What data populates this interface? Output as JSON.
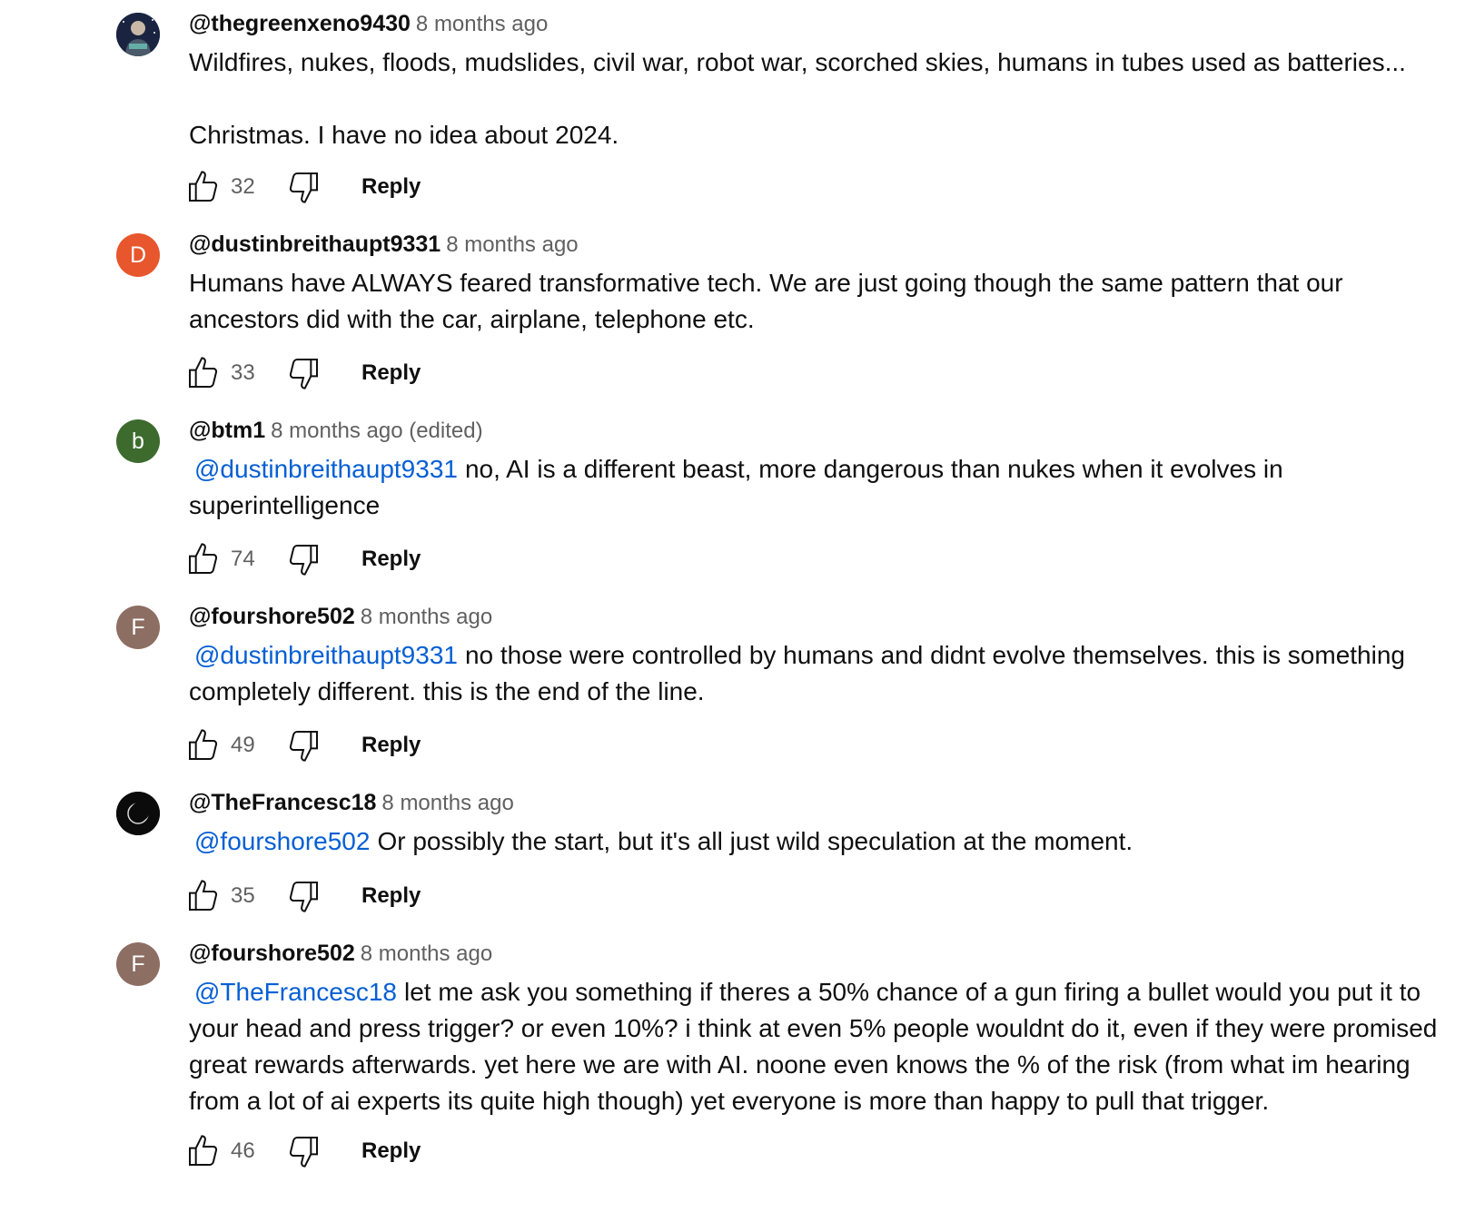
{
  "comments": [
    {
      "author": "@thegreenxeno9430",
      "time": "8 months ago",
      "avatar": {
        "letter": "",
        "color": "#1a2a4a",
        "icon": "profile-photo"
      },
      "mention": "",
      "text": "Wildfires, nukes, floods, mudslides, civil war, robot war, scorched skies, humans in tubes used as batteries...\n\nChristmas. I have no idea about 2024.",
      "likes": "32",
      "reply_label": "Reply"
    },
    {
      "author": "@dustinbreithaupt9331",
      "time": "8 months ago",
      "avatar": {
        "letter": "D",
        "color": "#e8562d"
      },
      "mention": "",
      "text": "Humans have ALWAYS feared transformative tech. We are just going though the same pattern that our\nancestors did with the car, airplane, telephone etc.",
      "likes": "33",
      "reply_label": "Reply"
    },
    {
      "author": "@btm1",
      "time": "8 months ago (edited)",
      "avatar": {
        "letter": "b",
        "color": "#3d6b2e"
      },
      "mention": "@dustinbreithaupt9331",
      "text": "no, AI is a different beast, more dangerous than nukes when it evolves in\nsuperintelligence",
      "likes": "74",
      "reply_label": "Reply"
    },
    {
      "author": "@fourshore502",
      "time": "8 months ago",
      "avatar": {
        "letter": "F",
        "color": "#8d6e63"
      },
      "mention": "@dustinbreithaupt9331",
      "text": "no those were controlled by humans and didnt evolve themselves. this is something\ncompletely different. this is the end of the line.",
      "likes": "49",
      "reply_label": "Reply"
    },
    {
      "author": "@TheFrancesc18",
      "time": "8 months ago",
      "avatar": {
        "letter": "",
        "color": "#111111",
        "icon": "eclipse-photo"
      },
      "mention": "@fourshore502",
      "text": "Or possibly the start, but it's all just wild speculation at the moment.",
      "likes": "35",
      "reply_label": "Reply"
    },
    {
      "author": "@fourshore502",
      "time": "8 months ago",
      "avatar": {
        "letter": "F",
        "color": "#8d6e63"
      },
      "mention": "@TheFrancesc18",
      "text": "let me ask you something if theres a 50% chance of a gun firing a bullet would you put it to\nyour head and press trigger? or even 10%? i think at even 5% people wouldnt do it, even if they were promised\ngreat rewards afterwards. yet here we are with AI. noone even knows the % of the risk (from what im hearing\nfrom a lot of ai experts its quite high though) yet everyone is more than happy to pull that trigger.",
      "likes": "46",
      "reply_label": "Reply"
    }
  ]
}
